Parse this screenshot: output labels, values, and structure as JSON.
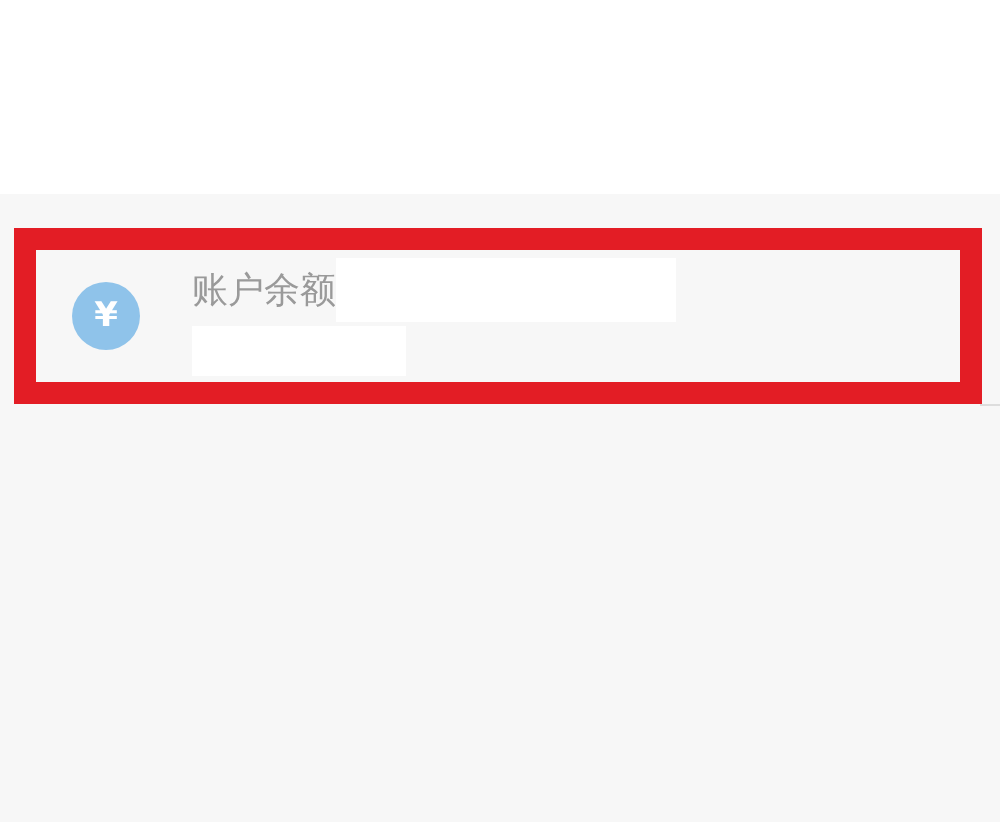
{
  "balance_row": {
    "icon": "¥",
    "label": "账户余额",
    "highlighted": true
  }
}
